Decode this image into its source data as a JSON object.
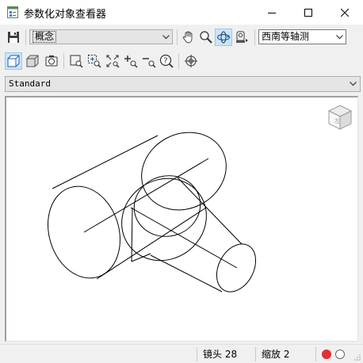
{
  "window": {
    "title": "参数化对象查看器",
    "controls": [
      "minimize-icon",
      "maximize-icon",
      "close-icon"
    ]
  },
  "toolbar": {
    "save_icon": "save-icon",
    "visual_style": "概念",
    "navigation_tools": [
      "pan-hand-icon",
      "zoom-magnifier-icon",
      "orbit-icon",
      "camera-view-icon"
    ],
    "view_direction": "西南等轴测"
  },
  "view_toolbar": {
    "tools": [
      "box-view-icon",
      "solid-view-icon",
      "camera-settings-icon",
      "zoom-window-icon",
      "zoom-center-icon",
      "zoom-extents-icon",
      "zoom-in-icon",
      "zoom-out-icon",
      "help-zoom-icon",
      "target-crosshair-icon"
    ]
  },
  "style_selector": {
    "value": "Standard"
  },
  "viewcube": {
    "label": "左"
  },
  "status": {
    "lens_label": "镜头 28",
    "zoom_label": "缩放 2",
    "indicator_colors": [
      "#e03030",
      "#ffffff"
    ]
  },
  "colors": {
    "active_button": "#cce4f7",
    "record_red": "#e03030"
  }
}
